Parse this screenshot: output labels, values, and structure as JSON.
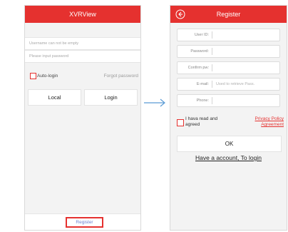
{
  "login_screen": {
    "title": "XVRView",
    "username_placeholder": "Username can not be empty",
    "password_placeholder": "Please input password",
    "auto_login_label": "Auto-login",
    "forgot_password_label": "Forgot password",
    "local_button_label": "Local",
    "login_button_label": "Login",
    "register_button_label": "Register"
  },
  "register_screen": {
    "title": "Register",
    "back_icon": "back-arrow-circle-icon",
    "fields": [
      {
        "label": "User ID:",
        "placeholder": ""
      },
      {
        "label": "Password:",
        "placeholder": ""
      },
      {
        "label": "Confirm pw:",
        "placeholder": ""
      },
      {
        "label": "E-mail:",
        "placeholder": "Used to retrieve Pass."
      },
      {
        "label": "Phone:",
        "placeholder": ""
      }
    ],
    "agree_text": "I hava read and agreed",
    "privacy_link_label": "Privacy Policy Agreement",
    "ok_button_label": "OK",
    "login_link_label": "Have a account, To login"
  },
  "colors": {
    "brand_red": "#e5312f",
    "link_blue": "#6a7fd0",
    "arrow_blue": "#5b9bd5"
  }
}
